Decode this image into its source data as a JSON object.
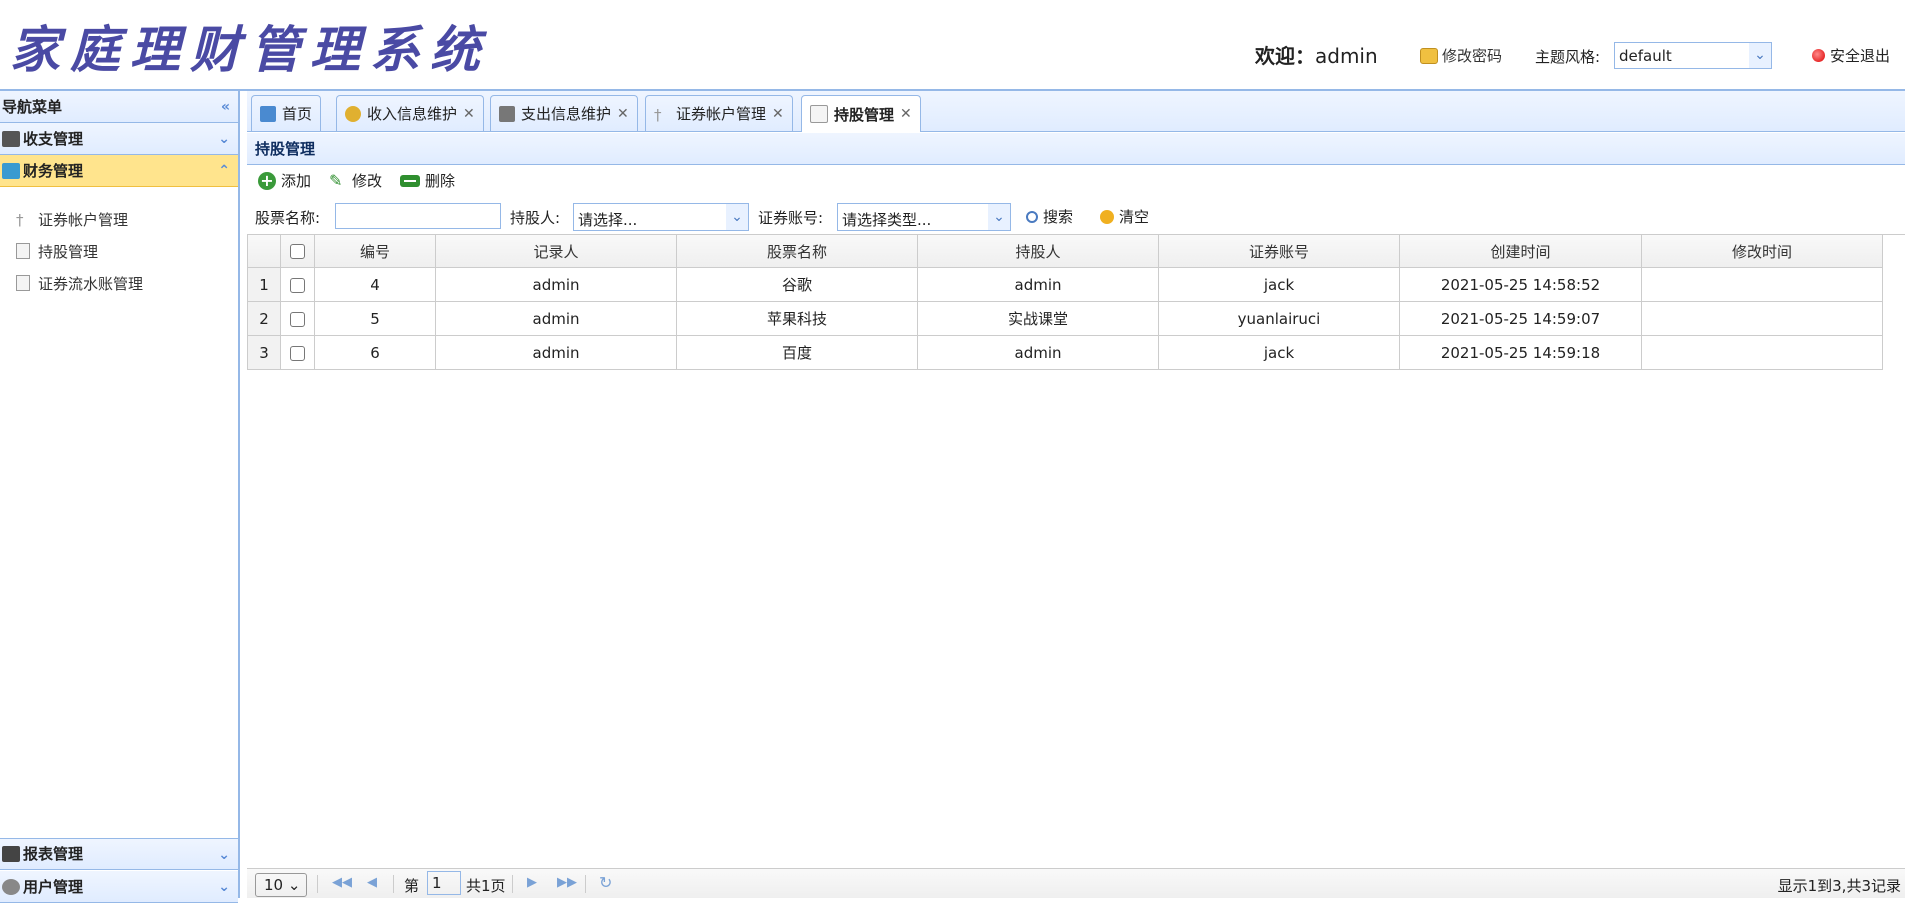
{
  "app": {
    "title": "家庭理财管理系统"
  },
  "header": {
    "welcome_label": "欢迎：",
    "user": "admin",
    "change_password": "修改密码",
    "theme_label": "主题风格:",
    "theme_value": "default",
    "logout": "安全退出"
  },
  "sidebar": {
    "title": "导航菜单",
    "groups": [
      {
        "label": "收支管理"
      },
      {
        "label": "财务管理"
      },
      {
        "label": "报表管理"
      },
      {
        "label": "用户管理"
      }
    ],
    "items": [
      {
        "label": "证券帐户管理"
      },
      {
        "label": "持股管理"
      },
      {
        "label": "证券流水账管理"
      }
    ]
  },
  "tabs": [
    {
      "label": "首页"
    },
    {
      "label": "收入信息维护"
    },
    {
      "label": "支出信息维护"
    },
    {
      "label": "证券帐户管理"
    },
    {
      "label": "持股管理"
    }
  ],
  "content": {
    "panel_title": "持股管理",
    "toolbar": {
      "add": "添加",
      "edit": "修改",
      "delete": "删除"
    },
    "search": {
      "stock_name_label": "股票名称:",
      "stock_name_value": "",
      "holder_label": "持股人:",
      "holder_value": "请选择...",
      "account_label": "证券账号:",
      "account_value": "请选择类型...",
      "search_btn": "搜索",
      "clear_btn": "清空"
    },
    "table": {
      "columns": [
        "编号",
        "记录人",
        "股票名称",
        "持股人",
        "证券账号",
        "创建时间",
        "修改时间"
      ],
      "rows": [
        {
          "rn": "1",
          "id": "4",
          "recorder": "admin",
          "stock": "谷歌",
          "holder": "admin",
          "account": "jack",
          "created": "2021-05-25 14:58:52",
          "modified": ""
        },
        {
          "rn": "2",
          "id": "5",
          "recorder": "admin",
          "stock": "苹果科技",
          "holder": "实战课堂",
          "account": "yuanlairuci",
          "created": "2021-05-25 14:59:07",
          "modified": ""
        },
        {
          "rn": "3",
          "id": "6",
          "recorder": "admin",
          "stock": "百度",
          "holder": "admin",
          "account": "jack",
          "created": "2021-05-25 14:59:18",
          "modified": ""
        }
      ]
    },
    "pager": {
      "page_size": "10",
      "page_prefix": "第",
      "page_num": "1",
      "page_total": "共1页",
      "summary": "显示1到3,共3记录"
    }
  },
  "colors": {
    "border": "#95b8e7",
    "header_grad": "#e0ecff",
    "active_group": "#ffe48d",
    "title": "#4a4aa4"
  }
}
